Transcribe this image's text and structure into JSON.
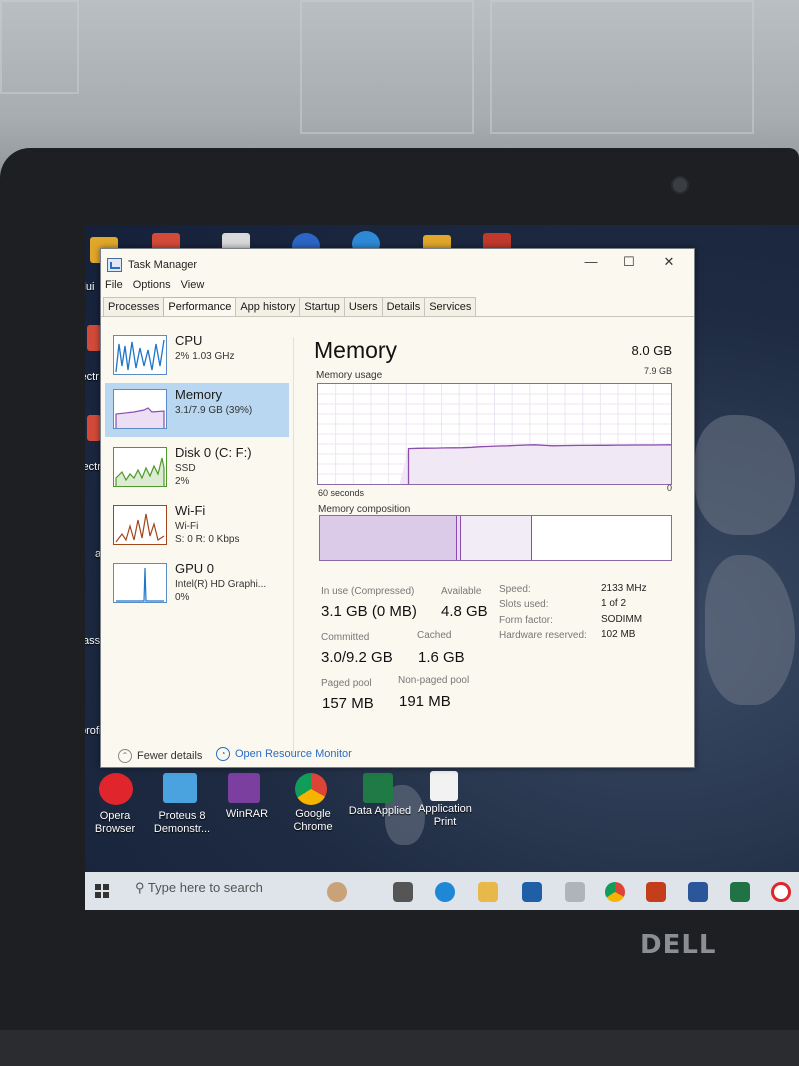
{
  "window": {
    "title": "Task Manager",
    "controls": {
      "minimize": "—",
      "maximize": "☐",
      "close": "✕"
    }
  },
  "menu": [
    "File",
    "Options",
    "View"
  ],
  "tabs": [
    "Processes",
    "Performance",
    "App history",
    "Startup",
    "Users",
    "Details",
    "Services"
  ],
  "active_tab": "Performance",
  "sidebar": [
    {
      "name": "CPU",
      "line1": "2%  1.03 GHz",
      "line2": "",
      "color": "#1f76c8",
      "selected": false
    },
    {
      "name": "Memory",
      "line1": "3.1/7.9 GB (39%)",
      "line2": "",
      "color": "#8b4db0",
      "selected": true
    },
    {
      "name": "Disk 0 (C: F:)",
      "line1": "SSD",
      "line2": "2%",
      "color": "#4d9a2b",
      "selected": false
    },
    {
      "name": "Wi-Fi",
      "line1": "Wi-Fi",
      "line2": "S: 0 R: 0 Kbps",
      "color": "#a3461b",
      "selected": false
    },
    {
      "name": "GPU 0",
      "line1": "Intel(R) HD Graphi...",
      "line2": "0%",
      "color": "#1f76c8",
      "selected": false
    }
  ],
  "main": {
    "title": "Memory",
    "total": "8.0 GB",
    "usage_label": "Memory usage",
    "usage_max": "7.9 GB",
    "axis_left": "60 seconds",
    "axis_right": "0",
    "composition_label": "Memory composition",
    "usage_series": [
      0,
      0,
      0,
      0,
      0,
      0,
      0,
      0,
      0,
      0,
      2.8,
      2.82,
      2.83,
      2.84,
      2.85,
      2.86,
      2.87,
      2.9,
      2.95,
      2.97,
      3.0,
      3.02,
      3.05,
      3.08,
      3.1,
      3.05,
      3.02,
      3.03,
      3.04,
      3.05,
      3.05,
      3.06,
      3.06,
      3.07,
      3.07,
      3.08,
      3.08,
      3.08,
      3.09,
      3.1
    ],
    "usage_ylim": [
      0,
      7.9
    ],
    "composition": {
      "in_use_fraction": 0.39,
      "modified_fraction": 0.01,
      "standby_fraction": 0.2,
      "free_fraction": 0.4
    },
    "stats": {
      "in_use_label": "In use (Compressed)",
      "in_use": "3.1 GB (0 MB)",
      "available_label": "Available",
      "available": "4.8 GB",
      "committed_label": "Committed",
      "committed": "3.0/9.2 GB",
      "cached_label": "Cached",
      "cached": "1.6 GB",
      "paged_label": "Paged pool",
      "paged": "157 MB",
      "nonpaged_label": "Non-paged pool",
      "nonpaged": "191 MB"
    },
    "details": [
      {
        "label": "Speed:",
        "value": "2133 MHz"
      },
      {
        "label": "Slots used:",
        "value": "1 of 2"
      },
      {
        "label": "Form factor:",
        "value": "SODIMM"
      },
      {
        "label": "Hardware reserved:",
        "value": "102 MB"
      }
    ]
  },
  "footer": {
    "fewer_details": "Fewer details",
    "open_monitor": "Open Resource Monitor"
  },
  "desktop": {
    "left_labels": [
      "ardui",
      "electr",
      "electr",
      "ab",
      "asse",
      "profil"
    ],
    "bottom_icons": [
      {
        "label1": "Opera",
        "label2": "Browser"
      },
      {
        "label1": "Proteus 8",
        "label2": "Demonstr..."
      },
      {
        "label1": "WinRAR",
        "label2": ""
      },
      {
        "label1": "Google",
        "label2": "Chrome"
      },
      {
        "label1": "Data Applied",
        "label2": ""
      },
      {
        "label1": "Application",
        "label2": "Print"
      }
    ]
  },
  "taskbar": {
    "search_placeholder": "Type here to search"
  },
  "brand": "DELL",
  "colors": {
    "memory_accent": "#8b4db0",
    "window_bg": "#fbf9ef",
    "selected_bg": "#b9d7f0"
  }
}
